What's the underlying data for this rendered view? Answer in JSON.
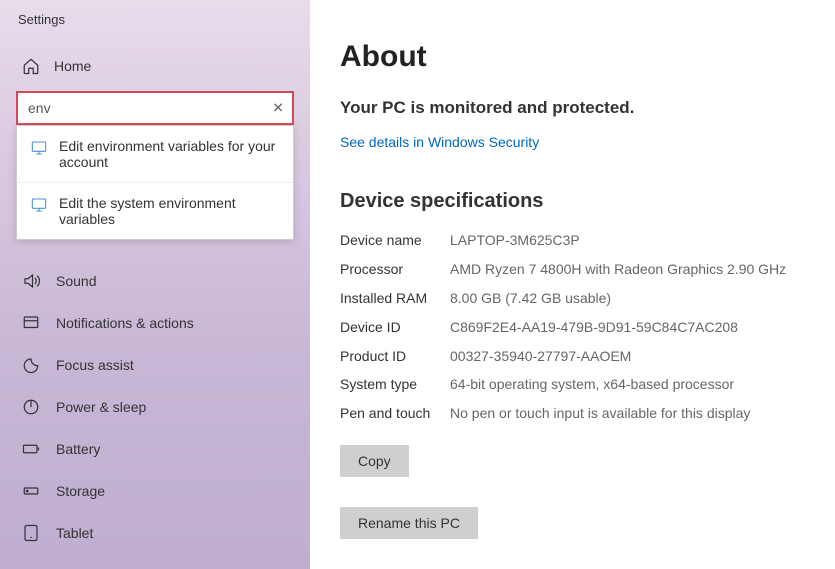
{
  "window": {
    "title": "Settings"
  },
  "sidebar": {
    "home": "Home",
    "search": {
      "value": "env"
    },
    "dropdown": [
      {
        "label": "Edit environment variables for your account"
      },
      {
        "label": "Edit the system environment variables"
      }
    ],
    "nav": [
      {
        "id": "sound",
        "label": "Sound"
      },
      {
        "id": "notifications",
        "label": "Notifications & actions"
      },
      {
        "id": "focus",
        "label": "Focus assist"
      },
      {
        "id": "power",
        "label": "Power & sleep"
      },
      {
        "id": "battery",
        "label": "Battery"
      },
      {
        "id": "storage",
        "label": "Storage"
      },
      {
        "id": "tablet",
        "label": "Tablet"
      }
    ]
  },
  "main": {
    "title": "About",
    "protected": "Your PC is monitored and protected.",
    "security_link": "See details in Windows Security",
    "spec_heading": "Device specifications",
    "specs": {
      "device_name": {
        "label": "Device name",
        "value": "LAPTOP-3M625C3P"
      },
      "processor": {
        "label": "Processor",
        "value": "AMD Ryzen 7 4800H with Radeon Graphics 2.90 GHz"
      },
      "ram": {
        "label": "Installed RAM",
        "value": "8.00 GB (7.42 GB usable)"
      },
      "device_id": {
        "label": "Device ID",
        "value": "C869F2E4-AA19-479B-9D91-59C84C7AC208"
      },
      "product_id": {
        "label": "Product ID",
        "value": "00327-35940-27797-AAOEM"
      },
      "system_type": {
        "label": "System type",
        "value": "64-bit operating system, x64-based processor"
      },
      "pen_touch": {
        "label": "Pen and touch",
        "value": "No pen or touch input is available for this display"
      }
    },
    "copy_btn": "Copy",
    "rename_btn": "Rename this PC"
  }
}
